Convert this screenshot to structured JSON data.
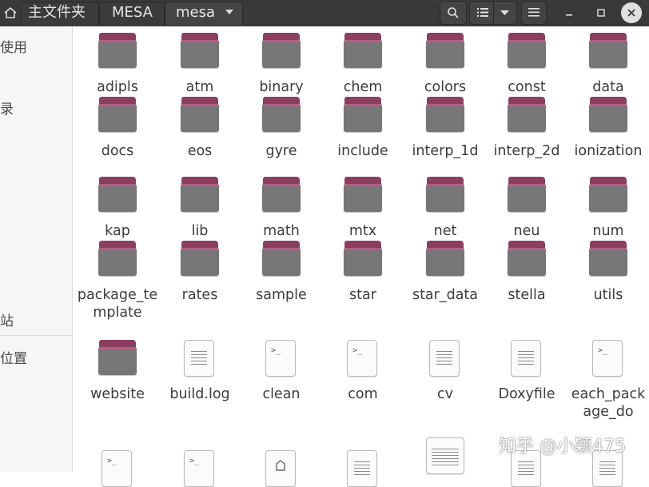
{
  "titlebar": {
    "breadcrumb": [
      "主文件夹",
      "MESA",
      "mesa"
    ]
  },
  "sidebar": {
    "items": [
      "使用",
      "录",
      "站",
      "位置"
    ]
  },
  "rows": [
    [
      {
        "name": "adipls",
        "type": "folder"
      },
      {
        "name": "atm",
        "type": "folder"
      },
      {
        "name": "binary",
        "type": "folder"
      },
      {
        "name": "chem",
        "type": "folder"
      },
      {
        "name": "colors",
        "type": "folder"
      },
      {
        "name": "const",
        "type": "folder"
      },
      {
        "name": "data",
        "type": "folder"
      }
    ],
    [
      {
        "name": "docs",
        "type": "folder"
      },
      {
        "name": "eos",
        "type": "folder"
      },
      {
        "name": "gyre",
        "type": "folder"
      },
      {
        "name": "include",
        "type": "folder"
      },
      {
        "name": "interp_1d",
        "type": "folder"
      },
      {
        "name": "interp_2d",
        "type": "folder"
      },
      {
        "name": "ionization",
        "type": "folder"
      }
    ],
    [
      {
        "name": "kap",
        "type": "folder"
      },
      {
        "name": "lib",
        "type": "folder"
      },
      {
        "name": "math",
        "type": "folder"
      },
      {
        "name": "mtx",
        "type": "folder"
      },
      {
        "name": "net",
        "type": "folder"
      },
      {
        "name": "neu",
        "type": "folder"
      },
      {
        "name": "num",
        "type": "folder"
      }
    ],
    [
      {
        "name": "package_template",
        "type": "folder"
      },
      {
        "name": "rates",
        "type": "folder"
      },
      {
        "name": "sample",
        "type": "folder"
      },
      {
        "name": "star",
        "type": "folder"
      },
      {
        "name": "star_data",
        "type": "folder"
      },
      {
        "name": "stella",
        "type": "folder"
      },
      {
        "name": "utils",
        "type": "folder"
      }
    ],
    [
      {
        "name": "website",
        "type": "folder"
      },
      {
        "name": "build.log",
        "type": "text"
      },
      {
        "name": "clean",
        "type": "script"
      },
      {
        "name": "com",
        "type": "script"
      },
      {
        "name": "cv",
        "type": "text"
      },
      {
        "name": "Doxyfile",
        "type": "text"
      },
      {
        "name": "each_package_do",
        "type": "script"
      }
    ]
  ],
  "partial_row": [
    {
      "type": "script"
    },
    {
      "type": "script"
    },
    {
      "type": "archive"
    },
    {
      "type": "text"
    },
    {
      "type": "image"
    },
    {
      "type": "text"
    },
    {
      "type": "text"
    }
  ],
  "watermark": "知乎 @小颖475",
  "colors": {
    "titlebar": "#3a3937",
    "folder_back": "#8a3f62",
    "folder_front": "#767676"
  }
}
